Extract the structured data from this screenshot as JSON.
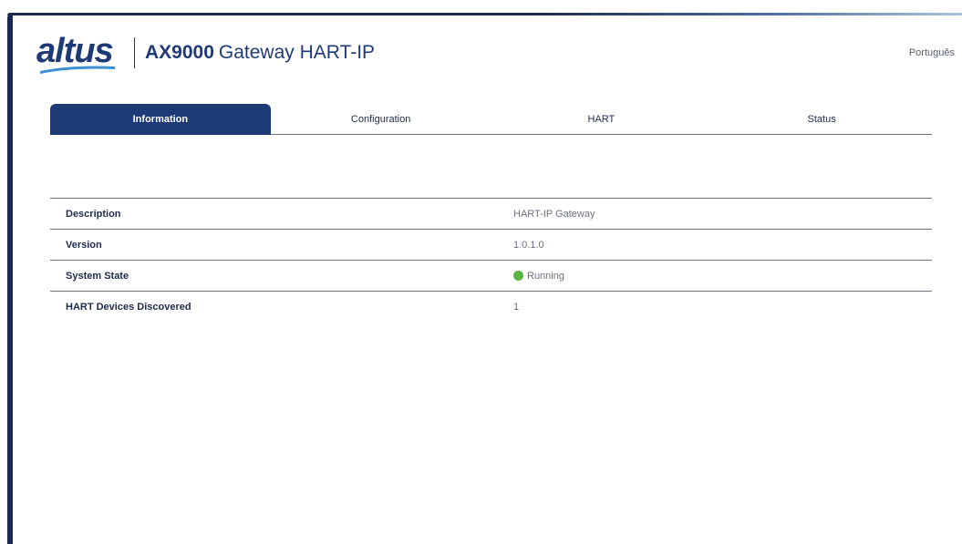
{
  "brand": {
    "logo_text": "altus",
    "model": "AX9000",
    "product": "Gateway HART-IP",
    "colors": {
      "primary": "#1e3a74",
      "accent": "#3a8fd6",
      "status_ok": "#5bb440"
    }
  },
  "header": {
    "language_link": "Português"
  },
  "tabs": [
    {
      "label": "Information",
      "active": true
    },
    {
      "label": "Configuration",
      "active": false
    },
    {
      "label": "HART",
      "active": false
    },
    {
      "label": "Status",
      "active": false
    }
  ],
  "info": {
    "rows": [
      {
        "label": "Description",
        "value": "HART-IP Gateway"
      },
      {
        "label": "Version",
        "value": "1.0.1.0"
      },
      {
        "label": "System State",
        "value": "Running",
        "icon": "status-green-dot-icon"
      },
      {
        "label": "HART Devices Discovered",
        "value": "1"
      }
    ]
  }
}
